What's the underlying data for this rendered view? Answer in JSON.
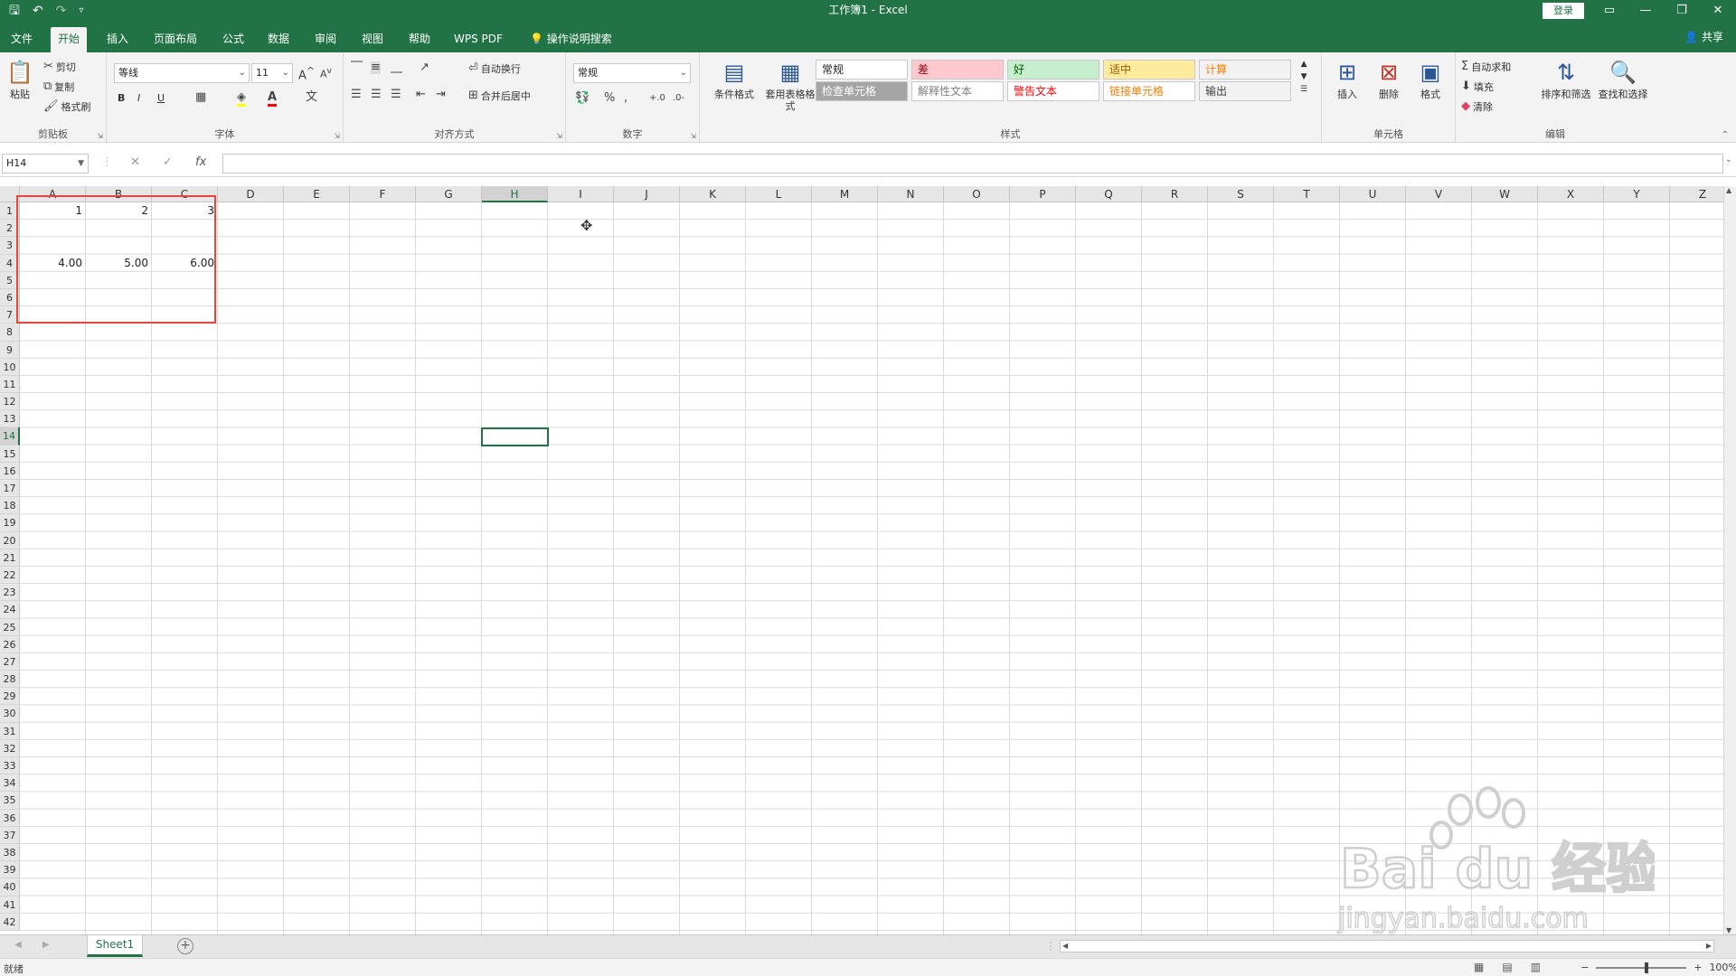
{
  "app": {
    "window_title": "工作簿1 - Excel",
    "login_label": "登录",
    "share_label": "共享"
  },
  "tabs": [
    {
      "label": "文件"
    },
    {
      "label": "开始"
    },
    {
      "label": "插入"
    },
    {
      "label": "页面布局"
    },
    {
      "label": "公式"
    },
    {
      "label": "数据"
    },
    {
      "label": "审阅"
    },
    {
      "label": "视图"
    },
    {
      "label": "帮助"
    },
    {
      "label": "WPS PDF"
    },
    {
      "label": "操作说明搜索"
    }
  ],
  "ribbon": {
    "clipboard": {
      "label": "剪贴板",
      "paste": "粘贴",
      "cut": "剪切",
      "copy": "复制",
      "format_painter": "格式刷"
    },
    "font": {
      "label": "字体",
      "font_name": "等线",
      "font_size": "11",
      "bold": "B",
      "italic": "I",
      "underline": "U"
    },
    "alignment": {
      "label": "对齐方式",
      "wrap": "自动换行",
      "merge": "合并后居中"
    },
    "number": {
      "label": "数字",
      "format": "常规"
    },
    "styles": {
      "label": "样式",
      "conditional": "条件格式",
      "table_format": "套用表格格式",
      "cells": [
        {
          "text": "常规",
          "bg": "#ffffff",
          "fg": "#222222"
        },
        {
          "text": "差",
          "bg": "#ffc7ce",
          "fg": "#9c0006"
        },
        {
          "text": "好",
          "bg": "#c6efce",
          "fg": "#006100"
        },
        {
          "text": "适中",
          "bg": "#ffeb9c",
          "fg": "#9c5700"
        },
        {
          "text": "计算",
          "bg": "#f2f2f2",
          "fg": "#fa7d00"
        },
        {
          "text": "检查单元格",
          "bg": "#a5a5a5",
          "fg": "#ffffff"
        },
        {
          "text": "解释性文本",
          "bg": "#ffffff",
          "fg": "#7f7f7f"
        },
        {
          "text": "警告文本",
          "bg": "#ffffff",
          "fg": "#ff0000"
        },
        {
          "text": "链接单元格",
          "bg": "#ffffff",
          "fg": "#fa7d00"
        },
        {
          "text": "输出",
          "bg": "#f2f2f2",
          "fg": "#3f3f3f"
        }
      ]
    },
    "cells_group": {
      "label": "单元格",
      "insert": "插入",
      "delete": "删除",
      "format": "格式"
    },
    "editing": {
      "label": "编辑",
      "autosum": "自动求和",
      "fill": "填充",
      "clear": "清除",
      "sort_filter": "排序和筛选",
      "find_select": "查找和选择"
    }
  },
  "formula_bar": {
    "name_box": "H14",
    "cancel": "✕",
    "enter": "✓",
    "fx": "fx",
    "content": ""
  },
  "grid": {
    "columns": [
      "A",
      "B",
      "C",
      "D",
      "E",
      "F",
      "G",
      "H",
      "I",
      "J",
      "K",
      "L",
      "M",
      "N",
      "O",
      "P",
      "Q",
      "R",
      "S",
      "T",
      "U",
      "V",
      "W",
      "X",
      "Y",
      "Z"
    ],
    "rows": [
      "1",
      "2",
      "3",
      "4",
      "5",
      "6",
      "7",
      "8",
      "9",
      "10",
      "11",
      "12",
      "13",
      "14",
      "15",
      "16",
      "17",
      "18",
      "19",
      "20",
      "21",
      "22",
      "23",
      "24",
      "25",
      "26",
      "27",
      "28",
      "29",
      "30",
      "31",
      "32",
      "33",
      "34",
      "35",
      "36",
      "37",
      "38",
      "39",
      "40",
      "41",
      "42"
    ],
    "selected_column": "H",
    "selected_row": "14",
    "cells": [
      {
        "ref": "A1",
        "col": 0,
        "row": 0,
        "value": "1"
      },
      {
        "ref": "B1",
        "col": 1,
        "row": 0,
        "value": "2"
      },
      {
        "ref": "C1",
        "col": 2,
        "row": 0,
        "value": "3"
      },
      {
        "ref": "A4",
        "col": 0,
        "row": 3,
        "value": "4.00"
      },
      {
        "ref": "B4",
        "col": 1,
        "row": 3,
        "value": "5.00"
      },
      {
        "ref": "C4",
        "col": 2,
        "row": 3,
        "value": "6.00"
      }
    ]
  },
  "sheets": [
    {
      "name": "Sheet1",
      "active": true
    }
  ],
  "status": {
    "ready": "就绪",
    "zoom": "100%"
  },
  "watermark": {
    "brand": "Bai du 经验",
    "url": "jingyan.baidu.com"
  }
}
